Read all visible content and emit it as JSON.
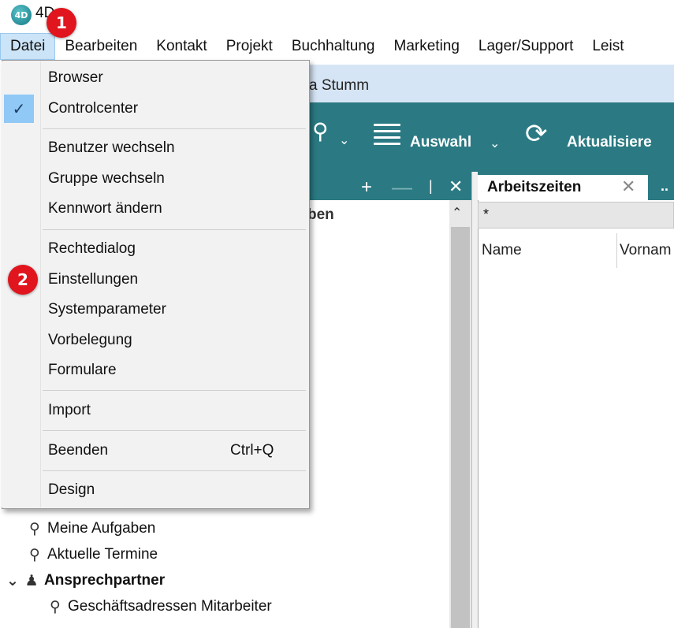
{
  "app": {
    "logo_text": "4D",
    "title": "4D"
  },
  "menubar": [
    "Datei",
    "Bearbeiten",
    "Kontakt",
    "Projekt",
    "Buchhaltung",
    "Marketing",
    "Lager/Support",
    "Leist"
  ],
  "window": {
    "title_partial": "a Stumm"
  },
  "toolbar": {
    "auswahl": "Auswahl",
    "aktualisieren": "Aktualisiere"
  },
  "tree_header_partial": "ben",
  "right_panel": {
    "tab_label": "Arbeitszeiten",
    "more": "..",
    "filter_value": "*",
    "columns": [
      "Name",
      "Vornam"
    ]
  },
  "dropdown": {
    "browser": "Browser",
    "controlcenter": "Controlcenter",
    "benutzer_wechseln": "Benutzer wechseln",
    "gruppe_wechseln": "Gruppe wechseln",
    "kennwort_aendern": "Kennwort ändern",
    "rechtedialog": "Rechtedialog",
    "einstellungen": "Einstellungen",
    "systemparameter": "Systemparameter",
    "vorbelegung": "Vorbelegung",
    "formulare": "Formulare",
    "import": "Import",
    "beenden": "Beenden",
    "beenden_shortcut": "Ctrl+Q",
    "design": "Design",
    "checked_item": "Controlcenter"
  },
  "tree": {
    "meine_aufgaben": "Meine Aufgaben",
    "aktuelle_termine": "Aktuelle Termine",
    "ansprechpartner": "Ansprechpartner",
    "geschaeftsadressen": "Geschäftsadressen Mitarbeiter"
  },
  "callouts": {
    "one": "1",
    "two": "2"
  },
  "colors": {
    "accent": "#2b7a83",
    "callout": "#e0151d",
    "menu_highlight": "#cce4f7",
    "check_bg": "#90c8f6"
  }
}
